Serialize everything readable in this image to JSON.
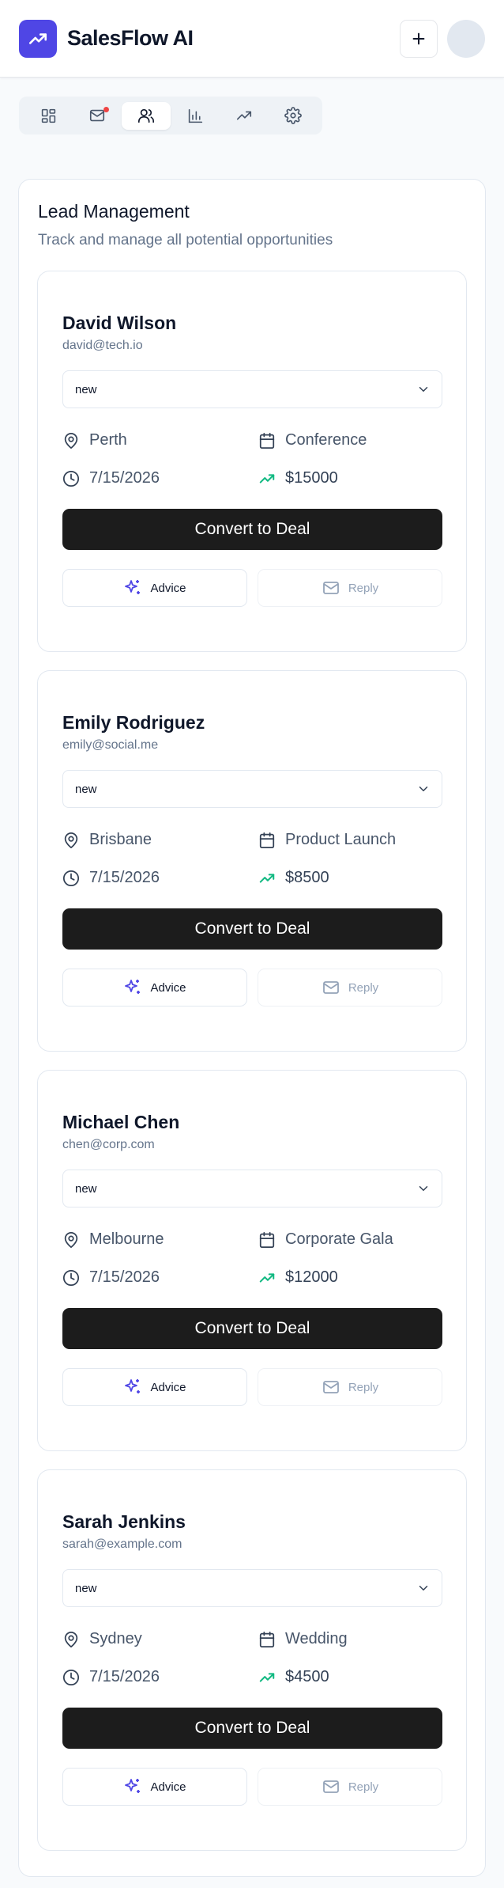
{
  "app": {
    "title": "SalesFlow AI"
  },
  "colors": {
    "brand": "#4f46e5",
    "notification": "#ef4444",
    "trend": "#10b981",
    "primary_button": "#1c1c1c",
    "reply_icon": "#94a3b8"
  },
  "header": {
    "logo_icon": "trending-up-icon",
    "actions": [
      {
        "name": "add-button",
        "icon": "plus-icon"
      },
      {
        "name": "avatar"
      }
    ]
  },
  "nav": {
    "items": [
      {
        "id": "dashboard",
        "icon": "dashboard-icon",
        "active": false,
        "notification": false
      },
      {
        "id": "inbox",
        "icon": "mail-icon",
        "active": false,
        "notification": true
      },
      {
        "id": "leads",
        "icon": "users-icon",
        "active": true,
        "notification": false
      },
      {
        "id": "analytics",
        "icon": "bar-chart-icon",
        "active": false,
        "notification": false
      },
      {
        "id": "trends",
        "icon": "trending-up-icon",
        "active": false,
        "notification": false
      },
      {
        "id": "settings",
        "icon": "gear-icon",
        "active": false,
        "notification": false
      }
    ]
  },
  "panel": {
    "title": "Lead Management",
    "subtitle": "Track and manage all potential opportunities"
  },
  "leads": [
    {
      "name": "David Wilson",
      "email": "david@tech.io",
      "status": "new",
      "location": "Perth",
      "event": "Conference",
      "date": "7/15/2026",
      "value": "$15000",
      "convert_label": "Convert to Deal",
      "advice_label": "Advice",
      "reply_label": "Reply"
    },
    {
      "name": "Emily Rodriguez",
      "email": "emily@social.me",
      "status": "new",
      "location": "Brisbane",
      "event": "Product Launch",
      "date": "7/15/2026",
      "value": "$8500",
      "convert_label": "Convert to Deal",
      "advice_label": "Advice",
      "reply_label": "Reply"
    },
    {
      "name": "Michael Chen",
      "email": "chen@corp.com",
      "status": "new",
      "location": "Melbourne",
      "event": "Corporate Gala",
      "date": "7/15/2026",
      "value": "$12000",
      "convert_label": "Convert to Deal",
      "advice_label": "Advice",
      "reply_label": "Reply"
    },
    {
      "name": "Sarah Jenkins",
      "email": "sarah@example.com",
      "status": "new",
      "location": "Sydney",
      "event": "Wedding",
      "date": "7/15/2026",
      "value": "$4500",
      "convert_label": "Convert to Deal",
      "advice_label": "Advice",
      "reply_label": "Reply"
    }
  ]
}
